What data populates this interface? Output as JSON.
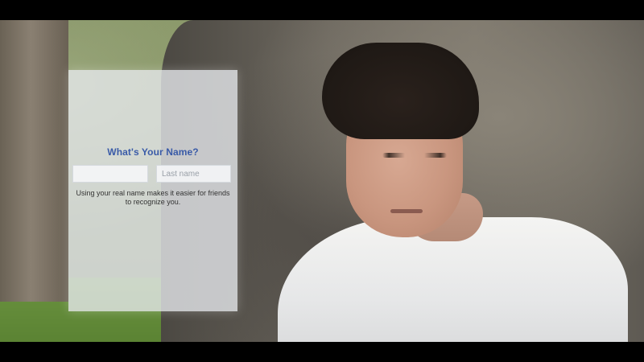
{
  "form": {
    "title": "What's Your Name?",
    "first_name_value": "",
    "last_name_placeholder": "Last name",
    "helper_text": "Using your real name makes it easier for friends to recognize you."
  },
  "colors": {
    "title_blue": "#3a5ba8",
    "panel_bg": "#e8ebee",
    "letterbox": "#000000"
  }
}
